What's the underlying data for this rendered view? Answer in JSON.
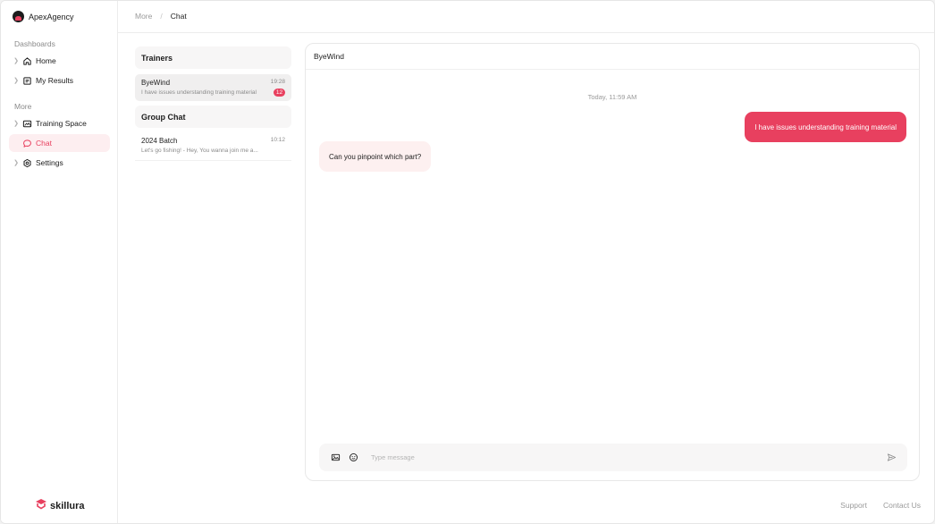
{
  "brand": {
    "name": "ApexAgency"
  },
  "sidebar": {
    "sections": [
      {
        "title": "Dashboards"
      },
      {
        "title": "More"
      }
    ],
    "items": [
      {
        "label": "Home",
        "icon": "home-icon"
      },
      {
        "label": "My Results",
        "icon": "results-icon"
      },
      {
        "label": "Training Space",
        "icon": "training-icon"
      },
      {
        "label": "Chat",
        "icon": "chat-icon",
        "active": true
      },
      {
        "label": "Settings",
        "icon": "settings-icon"
      }
    ],
    "footer_logo": "skillura"
  },
  "breadcrumb": {
    "parent": "More",
    "separator": "/",
    "current": "Chat"
  },
  "conversations": {
    "groups": [
      {
        "title": "Trainers",
        "items": [
          {
            "name": "ByeWind",
            "preview": "I have issues understanding training material",
            "time": "19:28",
            "unread": "12"
          }
        ]
      },
      {
        "title": "Group Chat",
        "items": [
          {
            "name": "2024 Batch",
            "preview": "Let's go fishing! - Hey, You wanna join me a...",
            "time": "10:12"
          }
        ]
      }
    ]
  },
  "chat": {
    "header_name": "ByeWind",
    "day_label": "Today, 11:59 AM",
    "messages": [
      {
        "direction": "out",
        "text": "I have issues understanding training material"
      },
      {
        "direction": "in",
        "text": "Can you pinpoint which part?"
      }
    ],
    "composer": {
      "placeholder": "Type message",
      "value": ""
    }
  },
  "footer": {
    "links": [
      "Support",
      "Contact Us"
    ]
  },
  "colors": {
    "accent": "#e8405f",
    "accent_soft": "#fdeef0",
    "bubble_in": "#fdf0f0"
  }
}
